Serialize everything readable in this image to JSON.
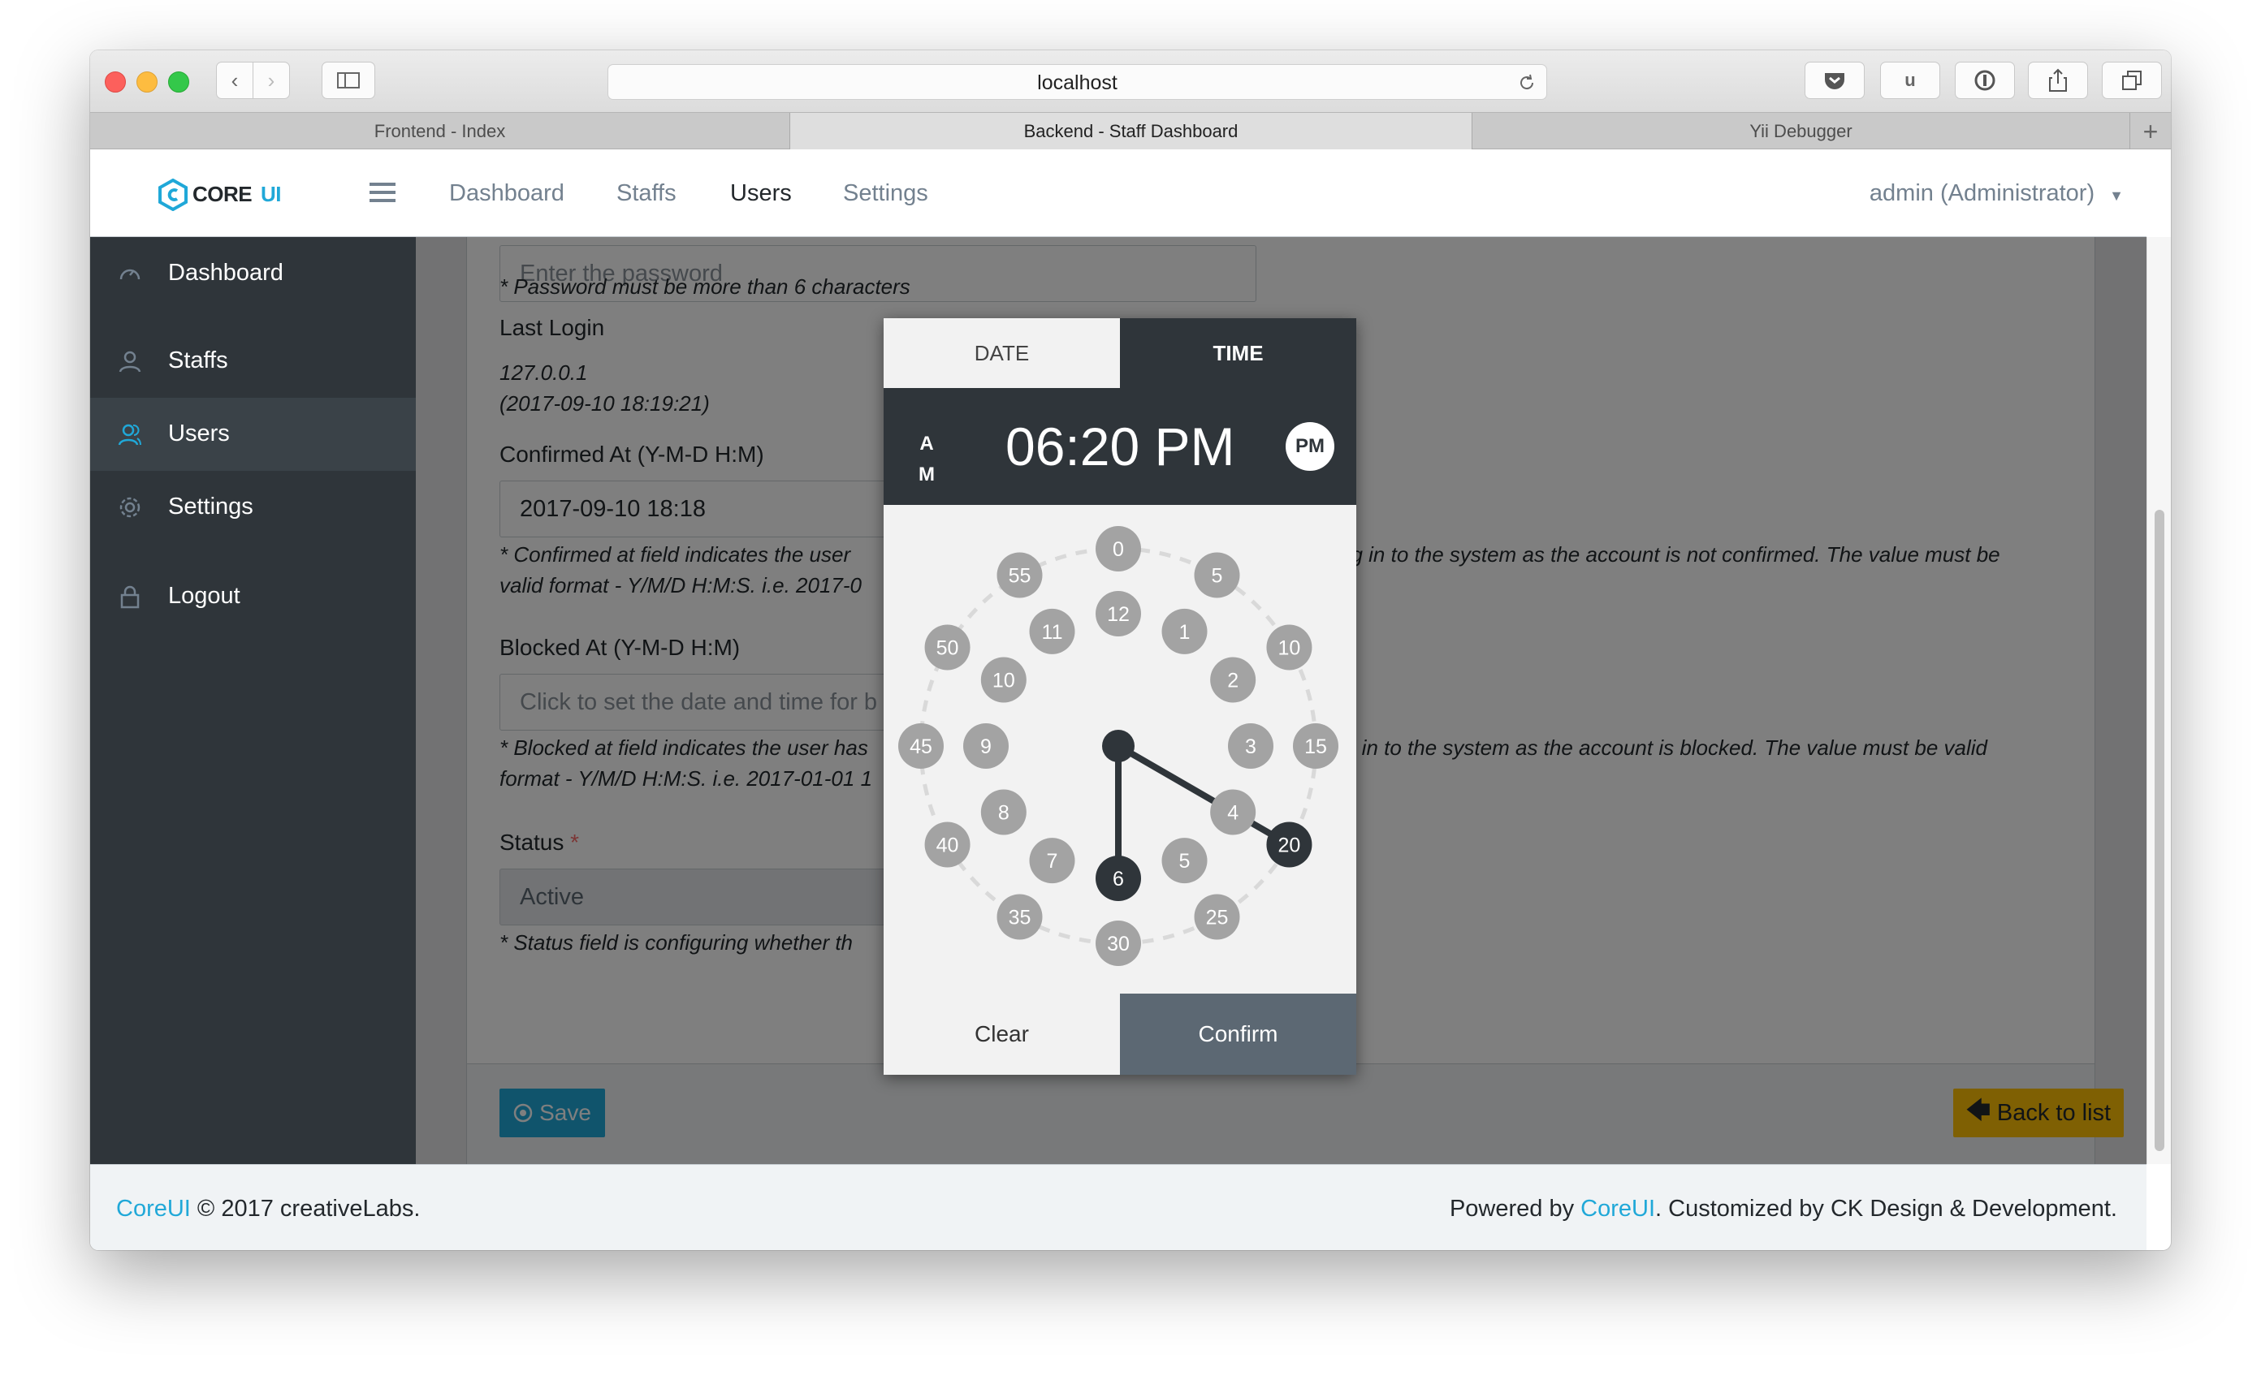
{
  "browser": {
    "url": "localhost",
    "tabs": [
      "Frontend - Index",
      "Backend - Staff Dashboard",
      "Yii Debugger"
    ],
    "ext_u": "u"
  },
  "header": {
    "brand_a": "CORE",
    "brand_b": "UI",
    "nav": [
      "Dashboard",
      "Staffs",
      "Users",
      "Settings"
    ],
    "user": "admin (Administrator)"
  },
  "sidebar": {
    "items": [
      {
        "label": "Dashboard",
        "icon": "speedometer-icon"
      },
      {
        "label": "Staffs",
        "icon": "user-icon"
      },
      {
        "label": "Users",
        "icon": "users-icon"
      },
      {
        "label": "Settings",
        "icon": "gear-icon"
      },
      {
        "label": "Logout",
        "icon": "lock-icon"
      }
    ]
  },
  "form": {
    "password_placeholder": "Enter the password",
    "password_help": "* Password must be more than 6 characters",
    "last_login_label": "Last Login",
    "last_login_ip": "127.0.0.1",
    "last_login_time": "(2017-09-10 18:19:21)",
    "confirmed_label": "Confirmed At (Y-M-D H:M)",
    "confirmed_value": "2017-09-10 18:18",
    "confirmed_help_1a": "* Confirmed at field indicates the user",
    "confirmed_help_1b": "og in to the system as the account is not confirmed. The value must be",
    "confirmed_help_2": "valid format - Y/M/D H:M:S. i.e. 2017-0",
    "blocked_label": "Blocked At (Y-M-D H:M)",
    "blocked_placeholder": "Click to set the date and time for b",
    "blocked_help_1a": "* Blocked at field indicates the user has",
    "blocked_help_1b": "g in to the system as the account is blocked. The value must be valid",
    "blocked_help_2": "format - Y/M/D H:M:S. i.e. 2017-01-01 1",
    "status_label": "Status",
    "status_required": "*",
    "status_value": "Active",
    "status_help": "* Status field is configuring whether th",
    "save_label": "Save",
    "back_label": "Back to list"
  },
  "picker": {
    "tab_date": "DATE",
    "tab_time": "TIME",
    "am_a": "A",
    "am_m": "M",
    "time": "06:20 PM",
    "pm_label": "PM",
    "clear_label": "Clear",
    "confirm_label": "Confirm",
    "selected_hour": 6,
    "selected_minute": 20,
    "outer_labels": [
      "0",
      "5",
      "10",
      "15",
      "20",
      "25",
      "30",
      "35",
      "40",
      "45",
      "50",
      "55"
    ],
    "inner_labels": [
      "12",
      "1",
      "2",
      "3",
      "4",
      "5",
      "6",
      "7",
      "8",
      "9",
      "10",
      "11"
    ]
  },
  "footer": {
    "left_link": "CoreUI",
    "left_text": " © 2017 creativeLabs.",
    "right_prefix": "Powered by ",
    "right_link": "CoreUI",
    "right_suffix": ". Customized by CK Design & Development."
  },
  "colors": {
    "accent": "#20a8d8",
    "warning": "#ffc107",
    "sidebar": "#2f353a",
    "picker_dark": "#2f353a"
  }
}
